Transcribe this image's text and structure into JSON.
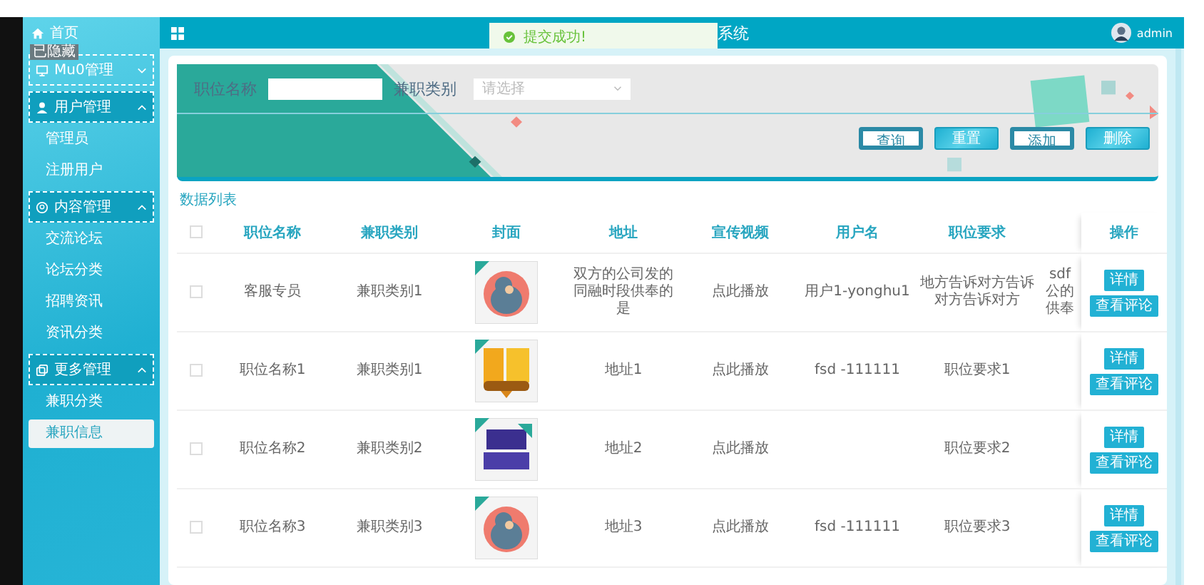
{
  "header": {
    "title": "系统",
    "user": "admin"
  },
  "toast": {
    "message": "提交成功!"
  },
  "tooltip": "已隐藏",
  "sidebar": {
    "items": [
      {
        "kind": "link",
        "label": "首页",
        "selected": false
      },
      {
        "kind": "group",
        "label": "Mu0管理",
        "expanded": false
      },
      {
        "kind": "group",
        "label": "用户管理",
        "expanded": true,
        "children": [
          {
            "label": "管理员",
            "selected": false
          },
          {
            "label": "注册用户",
            "selected": false
          }
        ]
      },
      {
        "kind": "group",
        "label": "内容管理",
        "expanded": true,
        "children": [
          {
            "label": "交流论坛",
            "selected": false
          },
          {
            "label": "论坛分类",
            "selected": false
          },
          {
            "label": "招聘资讯",
            "selected": false
          },
          {
            "label": "资讯分类",
            "selected": false
          }
        ]
      },
      {
        "kind": "group",
        "label": "更多管理",
        "expanded": true,
        "children": [
          {
            "label": "兼职分类",
            "selected": false
          },
          {
            "label": "兼职信息",
            "selected": true
          }
        ]
      }
    ]
  },
  "search": {
    "fields": [
      {
        "kind": "text",
        "label": "职位名称"
      },
      {
        "kind": "select",
        "label": "兼职类别",
        "placeholder": "请选择"
      }
    ],
    "buttons": [
      {
        "label": "查询",
        "kind": "outline"
      },
      {
        "label": "重置",
        "kind": "filled"
      },
      {
        "label": "添加",
        "kind": "outline"
      },
      {
        "label": "删除",
        "kind": "filled"
      }
    ]
  },
  "table": {
    "title": "数据列表",
    "all_checked": false,
    "columns": [
      "职位名称",
      "兼职类别",
      "封面",
      "地址",
      "宣传视频",
      "用户名",
      "职位要求"
    ],
    "action_header": "操作",
    "rows": [
      {
        "checked": false,
        "name": "客服专员",
        "category": "兼职类别1",
        "address": "双方的公司发的同融时段供奉的是",
        "video": "点此播放",
        "username": "用户1-yonghu1",
        "requirement": "地方告诉对方告诉对方告诉对方",
        "column_9": "sdf 公的供奉",
        "actions": [
          "详情",
          "查看评论"
        ]
      },
      {
        "checked": false,
        "name": "职位名称1",
        "category": "兼职类别1",
        "address": "地址1",
        "video": "点此播放",
        "username": "fsd -111111",
        "requirement": "职位要求1",
        "actions": [
          "详情",
          "查看评论"
        ]
      },
      {
        "checked": false,
        "name": "职位名称2",
        "category": "兼职类别2",
        "address": "地址2",
        "video": "点此播放",
        "requirement": "职位要求2",
        "actions": [
          "详情",
          "查看评论"
        ]
      },
      {
        "checked": false,
        "name": "职位名称3",
        "category": "兼职类别3",
        "address": "地址3",
        "video": "点此播放",
        "username": "fsd -111111",
        "requirement": "职位要求3",
        "actions": [
          "详情",
          "查看评论"
        ]
      }
    ]
  }
}
